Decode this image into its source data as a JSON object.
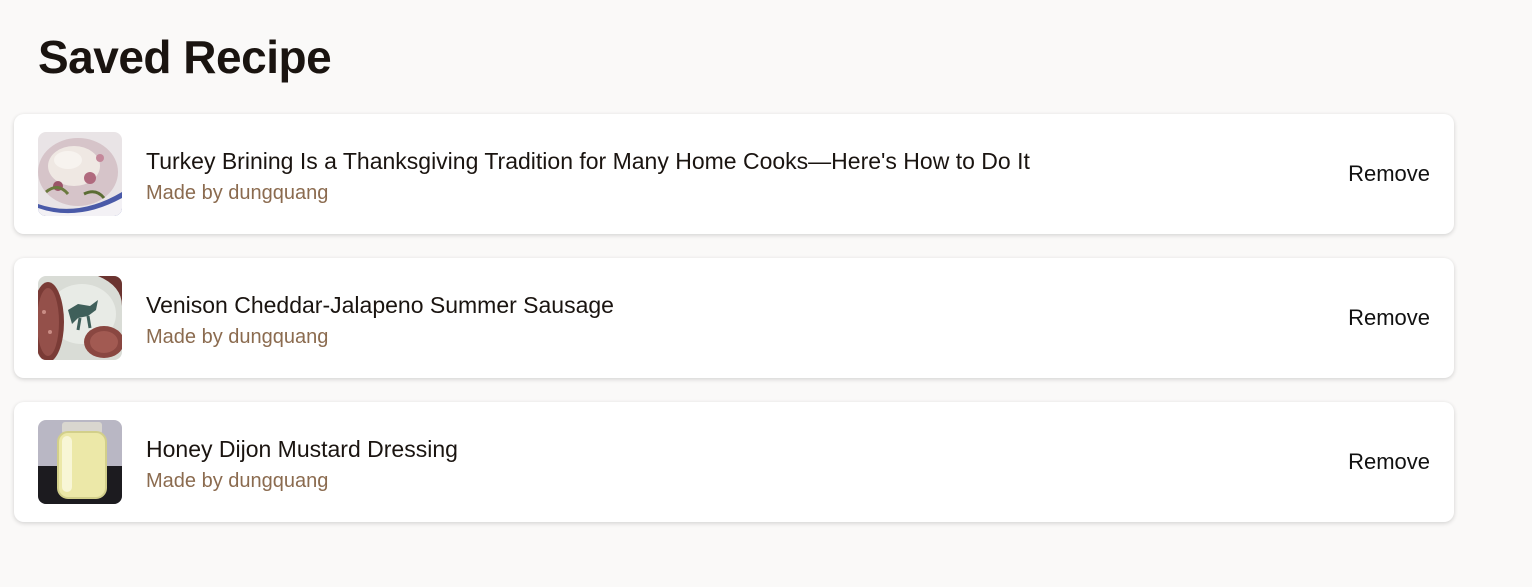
{
  "page": {
    "title": "Saved Recipe"
  },
  "recipes": [
    {
      "title": "Turkey Brining Is a Thanksgiving Tradition for Many Home Cooks—Here's How to Do It",
      "author": "Made by dungquang",
      "remove_label": "Remove",
      "image": "turkey-brine-photo"
    },
    {
      "title": "Venison Cheddar-Jalapeno Summer Sausage",
      "author": "Made by dungquang",
      "remove_label": "Remove",
      "image": "summer-sausage-photo"
    },
    {
      "title": "Honey Dijon Mustard Dressing",
      "author": "Made by dungquang",
      "remove_label": "Remove",
      "image": "mustard-dressing-jar-photo"
    }
  ],
  "colors": {
    "background": "#faf9f8",
    "card": "#ffffff",
    "author_text": "#8b6b4f",
    "title_text": "#1a1410"
  }
}
